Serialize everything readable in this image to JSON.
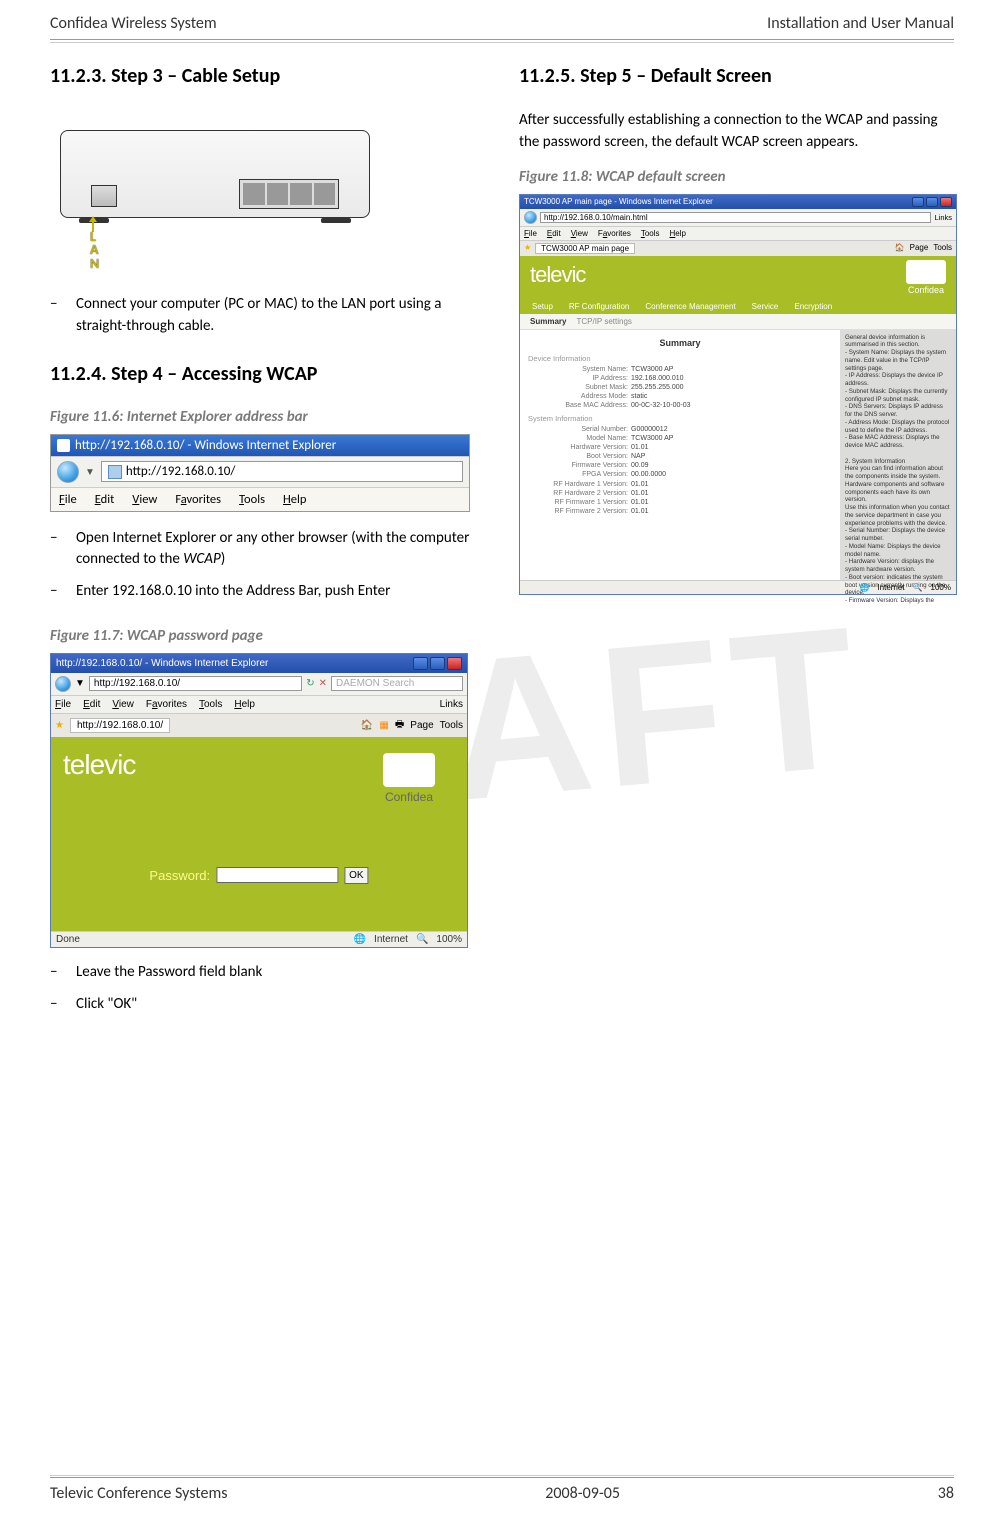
{
  "header": {
    "left": "Confidea Wireless System",
    "right": "Installation and User Manual"
  },
  "footer": {
    "left": "Televic Conference Systems",
    "center": "2008-09-05",
    "right": "38"
  },
  "watermark": "DRAFT",
  "left_col": {
    "h_step3": "11.2.3.  Step 3 – Cable Setup",
    "lan_label": "L\nA\nN",
    "step3_bullets": [
      "Connect your computer (PC or MAC) to the LAN port using a straight-through cable."
    ],
    "h_step4": "11.2.4.  Step 4 – Accessing WCAP",
    "fig116": "Figure 11.6: Internet Explorer address bar",
    "ie_title": "http://192.168.0.10/ - Windows Internet Explorer",
    "ie_url": "http://192.168.0.10/",
    "ie_menu": {
      "file": "File",
      "edit": "Edit",
      "view": "View",
      "favorites": "Favorites",
      "tools": "Tools",
      "help": "Help"
    },
    "step4_bullets_a": [
      "Open Internet Explorer or any other browser (with the computer connected to the WCAP)",
      "Enter 192.168.0.10 into the Address Bar, push Enter"
    ],
    "fig117": "Figure 11.7: WCAP password page",
    "pwd_win_title": "http://192.168.0.10/ - Windows Internet Explorer",
    "pwd_addr": "http://192.168.0.10/",
    "pwd_tab": "http://192.168.0.10/",
    "pwd_menu": {
      "file": "File",
      "edit": "Edit",
      "view": "View",
      "favorites": "Favorites",
      "tools": "Tools",
      "help": "Help"
    },
    "pwd_toolbar": {
      "page": "Page",
      "tools": "Tools"
    },
    "televic": "televic",
    "confidea": "Confidea",
    "pwd_label": "Password:",
    "pwd_value": "",
    "ok_label": "OK",
    "status_left": "Done",
    "status_mid": "Internet",
    "status_right": "100%",
    "search_placeholder": "DAEMON Search",
    "links_label": "Links",
    "step4_bullets_b": [
      "Leave the Password field blank",
      "Click \"OK\""
    ]
  },
  "right_col": {
    "h_step5": "11.2.5.  Step 5 – Default Screen",
    "intro": "After successfully establishing a connection to the WCAP and passing the password screen, the default WCAP screen appears.",
    "fig118": "Figure 11.8: WCAP default screen",
    "win_title": "TCW3000 AP main page - Windows Internet Explorer",
    "addr": "http://192.168.0.10/main.html",
    "tab": "TCW3000 AP main page",
    "televic": "televic",
    "confidea": "Confidea",
    "nav": [
      "Setup",
      "RF Configuration",
      "Conference Management",
      "Service",
      "Encryption"
    ],
    "subnav": [
      "Summary",
      "TCP/IP settings"
    ],
    "summary_title": "Summary",
    "device_info_label": "Device Information",
    "system_info_label": "System Information",
    "device_kv": [
      {
        "k": "System Name:",
        "v": "TCW3000 AP"
      },
      {
        "k": "IP Address:",
        "v": "192.168.000.010"
      },
      {
        "k": "Subnet Mask:",
        "v": "255.255.255.000"
      },
      {
        "k": "Address Mode:",
        "v": "static"
      },
      {
        "k": "Base MAC Address:",
        "v": "00-0C-32-10-00-03"
      }
    ],
    "system_kv": [
      {
        "k": "Serial Number:",
        "v": "G00000012"
      },
      {
        "k": "Model Name:",
        "v": "TCW3000 AP"
      },
      {
        "k": "Hardware Version:",
        "v": "01.01"
      },
      {
        "k": "Boot Version:",
        "v": "NAP"
      },
      {
        "k": "Firmware Version:",
        "v": "00.09"
      },
      {
        "k": "FPGA Version:",
        "v": "00.00.0000"
      },
      {
        "k": "RF Hardware 1 Version:",
        "v": "01.01"
      },
      {
        "k": "RF Hardware 2 Version:",
        "v": "01.01"
      },
      {
        "k": "RF Firmware 1 Version:",
        "v": "01.01"
      },
      {
        "k": "RF Firmware 2 Version:",
        "v": "01.01"
      }
    ],
    "summary_right": "General device information is summarised in this section.\n- System Name: Displays the system name. Edit value in the TCP/IP settings page.\n- IP Address: Displays the device IP address.\n- Subnet Mask: Displays the currently configured IP subnet mask.\n- DNS Servers: Displays IP address for the DNS server.\n- Address Mode: Displays the protocol used to define the IP address.\n- Base MAC Address: Displays the device MAC address.\n\n2. System Information\nHere you can find information about the components inside the system.\nHardware components and software components each have its own version.\nUse this information when you contact the service department in case you experience problems with the device.\n- Serial Number: Displays the device serial number.\n- Model Name: Displays the device model name.\n- Hardware Version: displays the system hardware version.\n- Boot version: indicates the system boot version currently running on the device.\n- Firmware Version: Displays the",
    "links_label": "Links",
    "status_mid": "Internet",
    "status_right": "100%"
  }
}
